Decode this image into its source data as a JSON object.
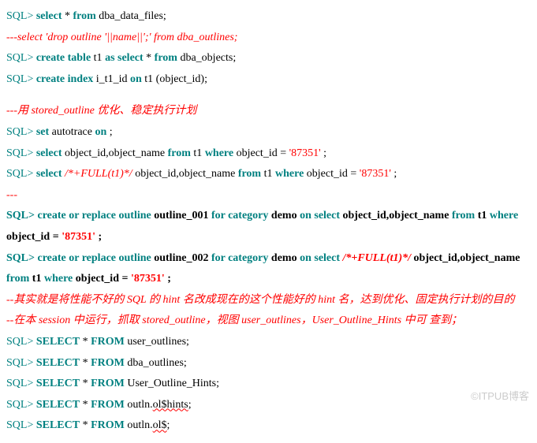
{
  "prompt": "SQL>",
  "l1": {
    "select": "select",
    "star": "* ",
    "from": "from",
    "tbl": " dba_data_files;"
  },
  "l2": "---select 'drop outline '||name||';' from dba_outlines;",
  "l3": {
    "create": "create",
    "table": "table",
    "t1": " t1 ",
    "as": "as",
    "select": "select",
    "star": " * ",
    "from": "from",
    "tbl": " dba_objects;"
  },
  "l4": {
    "create": "create",
    "index": "index",
    "rest": " i_t1_id ",
    "on": "on",
    "rest2": " t1 (object_id);"
  },
  "l5": "---用 stored_outline 优化、稳定执行计划",
  "l6": {
    "set": "set",
    "rest": " autotrace ",
    "on": "on",
    "semi": ";"
  },
  "l7": {
    "select": "select",
    "cols": " object_id,object_name ",
    "from": "from",
    "tbl": " t1 ",
    "where": "where",
    "cond": " object_id = ",
    "val": "'87351'",
    "semi": ";"
  },
  "l8": {
    "select": "select",
    "hint": " /*+FULL(t1)*/",
    "cols": " object_id,object_name ",
    "from": "from",
    "tbl": " t1 ",
    "where": "where",
    "cond": " object_id = ",
    "val": "'87351'",
    "semi": ";"
  },
  "l9": "---",
  "l10": {
    "p1": "create or replace outline",
    "name": " outline_001 ",
    "p2": "for category",
    "cat": " demo ",
    "p3": "on select",
    "cols": " object_id,object_name ",
    "p4": "from",
    "tbl": " t1 ",
    "p5": "where",
    "cond": " object_id = ",
    "val": "'87351'",
    "semi": ";"
  },
  "l11": {
    "p1": "create or replace outline",
    "name": " outline_002 ",
    "p2": "for category",
    "cat": " demo ",
    "p3": "on select",
    "hint": " /*+FULL(t1)*/ ",
    "cols": "object_id,object_name ",
    "p4": "from",
    "tbl": " t1 ",
    "p5": "where",
    "cond": " object_id = ",
    "val": "'87351'",
    "semi": ";"
  },
  "l12": "--其实就是将性能不好的 SQL 的 hint 名改成现在的这个性能好的 hint 名，达到优化、固定执行计划的目的",
  "l13": "--在本 session 中运行，抓取 stored_outline，视图 user_outlines，User_Outline_Hints 中可 查到；",
  "l14": {
    "sel": "SELECT",
    "star": " * ",
    "from": "FROM",
    "tbl": " user_outlines;"
  },
  "l15": {
    "sel": "SELECT",
    "star": " * ",
    "from": "FROM",
    "tbl": " dba_outlines;"
  },
  "l16": {
    "sel": "SELECT",
    "star": " * ",
    "from": "FROM",
    "tbl": " User_Outline_Hints;"
  },
  "l17": {
    "sel": "SELECT",
    "star": " * ",
    "from": "FROM",
    "pre": " outln.",
    "wv": "ol$hints",
    "semi": ";"
  },
  "l18": {
    "sel": "SELECT",
    "star": " * ",
    "from": "FROM",
    "pre": " outln.",
    "wv": "ol$",
    "semi": ";"
  },
  "watermark": "©ITPUB博客"
}
